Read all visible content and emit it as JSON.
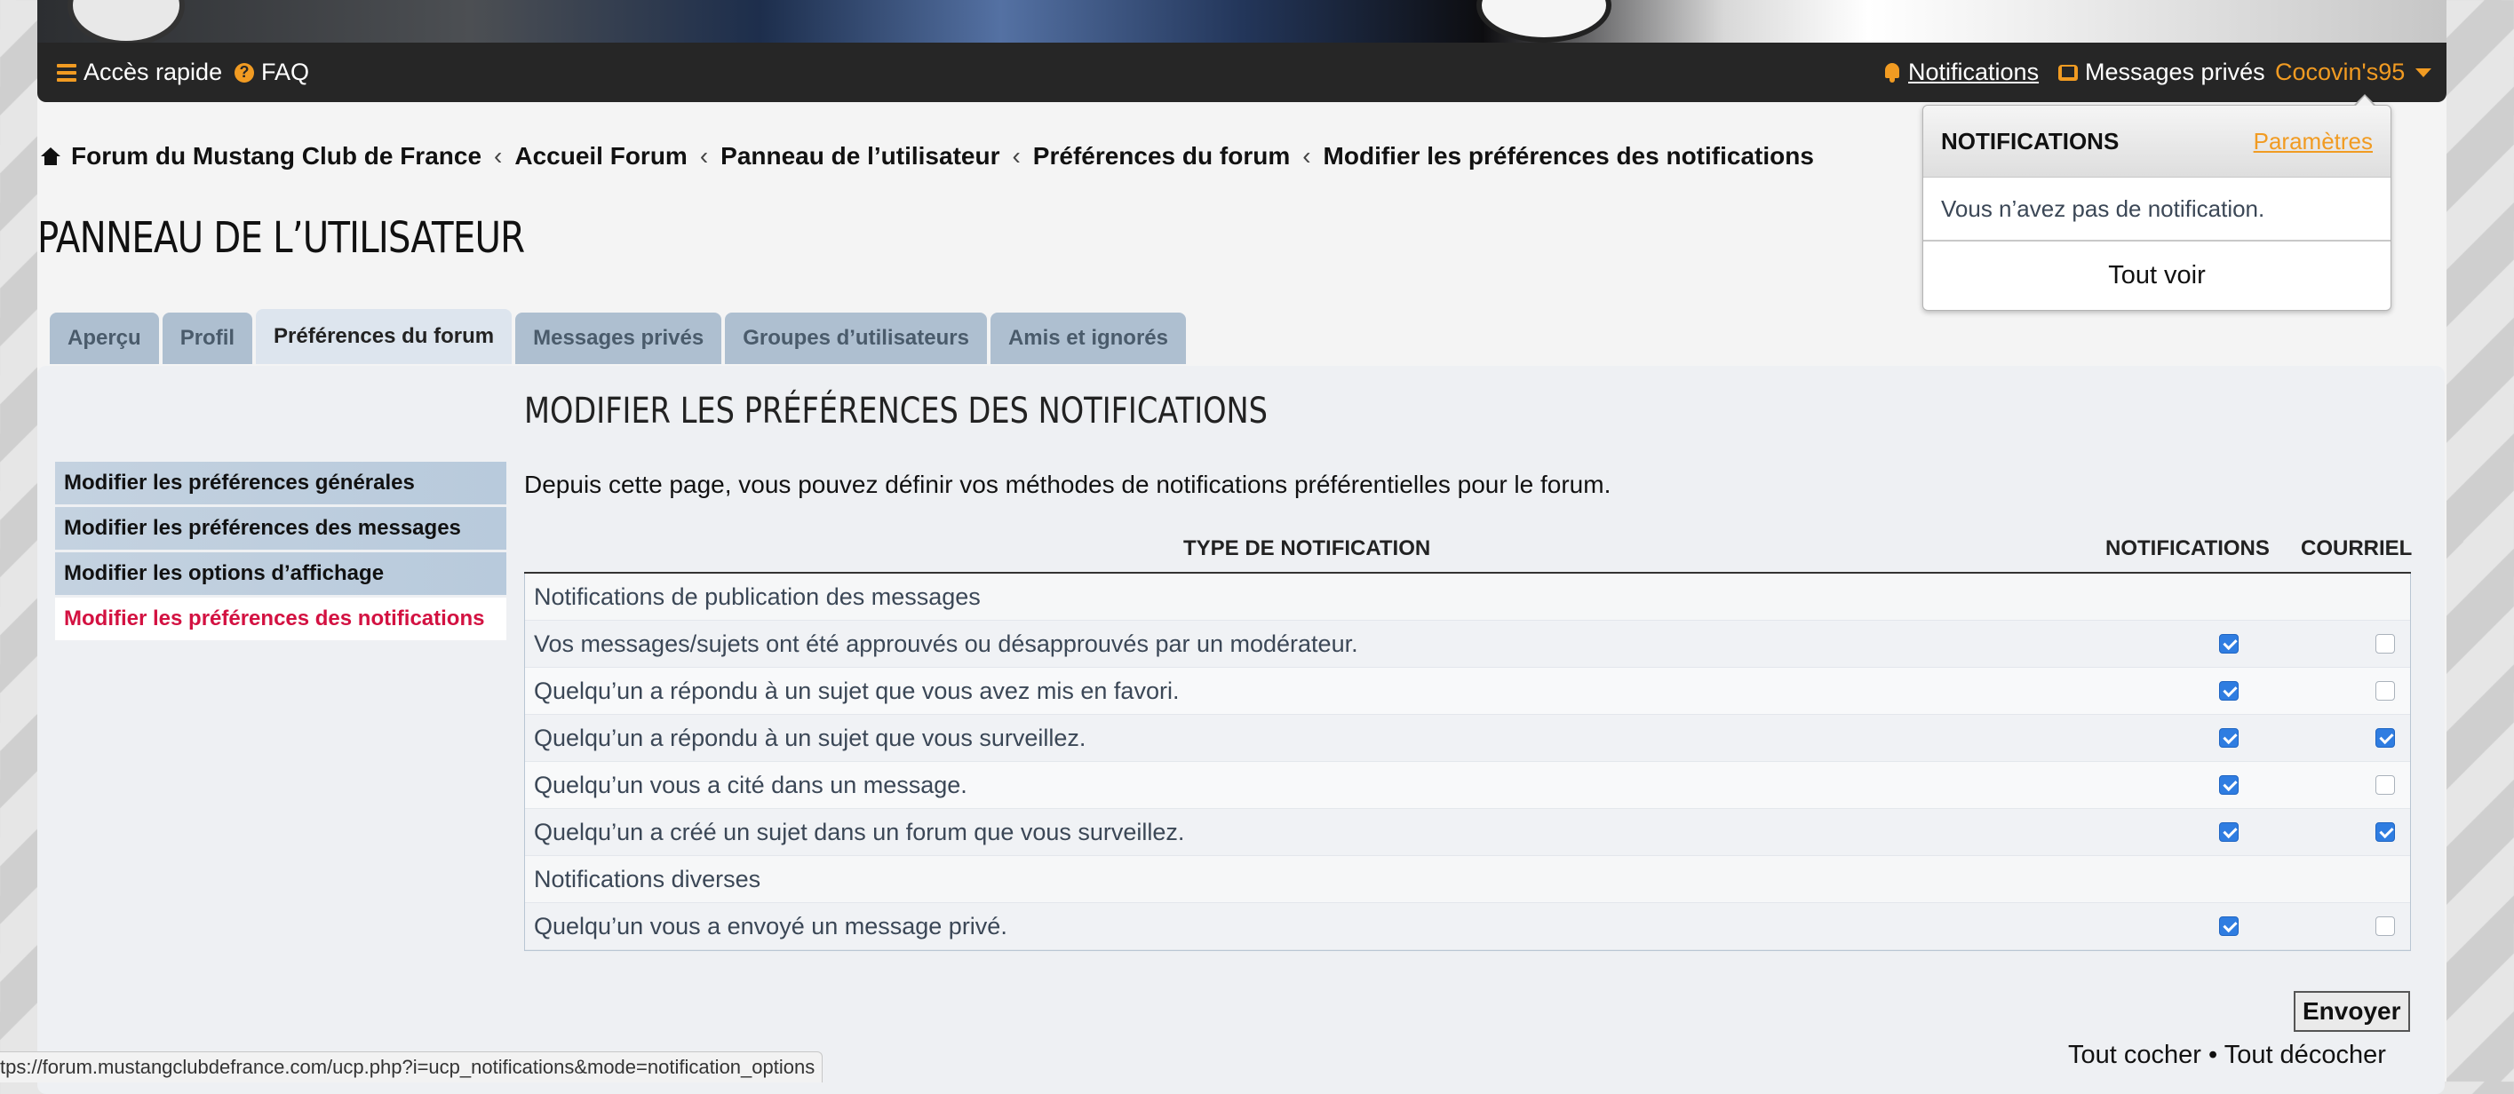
{
  "navbar": {
    "quick_access": "Accès rapide",
    "faq": "FAQ",
    "notifications": "Notifications",
    "private_messages": "Messages privés",
    "username": "Cocovin's95"
  },
  "breadcrumbs": [
    "Forum du Mustang Club de France",
    "Accueil Forum",
    "Panneau de l’utilisateur",
    "Préférences du forum",
    "Modifier les préférences des notifications"
  ],
  "page_title": "PANNEAU DE L’UTILISATEUR",
  "tabs": [
    "Aperçu",
    "Profil",
    "Préférences du forum",
    "Messages privés",
    "Groupes d’utilisateurs",
    "Amis et ignorés"
  ],
  "active_tab": 2,
  "sidebar": [
    "Modifier les préférences générales",
    "Modifier les préférences des messages",
    "Modifier les options d’affichage",
    "Modifier les préférences des notifications"
  ],
  "main": {
    "title": "MODIFIER LES PRÉFÉRENCES DES NOTIFICATIONS",
    "intro": "Depuis cette page, vous pouvez définir vos méthodes de notifications préférentielles pour le forum.",
    "col_type": "TYPE DE NOTIFICATION",
    "col_notifications": "NOTIFICATIONS",
    "col_email": "COURRIEL",
    "rows": [
      {
        "section": true,
        "label": "Notifications de publication des messages"
      },
      {
        "label": "Vos messages/sujets ont été approuvés ou désapprouvés par un modérateur.",
        "notif": true,
        "email": false
      },
      {
        "label": "Quelqu’un a répondu à un sujet que vous avez mis en favori.",
        "notif": true,
        "email": false
      },
      {
        "label": "Quelqu’un a répondu à un sujet que vous surveillez.",
        "notif": true,
        "email": true
      },
      {
        "label": "Quelqu’un vous a cité dans un message.",
        "notif": true,
        "email": false
      },
      {
        "label": "Quelqu’un a créé un sujet dans un forum que vous surveillez.",
        "notif": true,
        "email": true
      },
      {
        "section": true,
        "label": "Notifications diverses"
      },
      {
        "label": "Quelqu’un vous a envoyé un message privé.",
        "notif": true,
        "email": false
      }
    ],
    "submit": "Envoyer",
    "check_all": "Tout cocher",
    "separator": "•",
    "uncheck_all": "Tout décocher"
  },
  "dropdown": {
    "title": "NOTIFICATIONS",
    "settings": "Paramètres",
    "empty": "Vous n’avez pas de notification.",
    "see_all": "Tout voir"
  },
  "status_url": "tps://forum.mustangclubdefrance.com/ucp.php?i=ucp_notifications&mode=notification_options",
  "colors": {
    "accent": "#f19b22",
    "active_link": "#d31141",
    "checkbox": "#2f7de1"
  }
}
